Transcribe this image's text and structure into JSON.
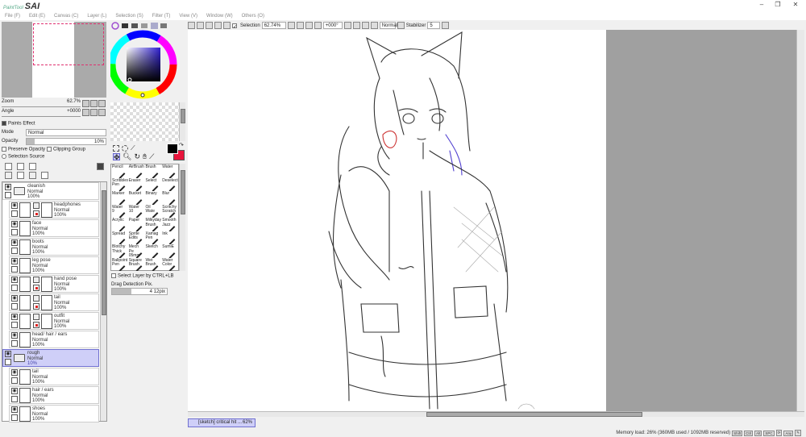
{
  "app": {
    "logo_small": "PaintTool",
    "logo": "SAI"
  },
  "menu": [
    "File (F)",
    "Edit (E)",
    "Canvas (C)",
    "Layer (L)",
    "Selection (S)",
    "Filter (T)",
    "View (V)",
    "Window (W)",
    "Others (O)"
  ],
  "toolbar": {
    "selection_label": "Selection",
    "zoom": "62.74%",
    "angle": "+000°",
    "mode": "Normal",
    "stabilizer_label": "Stabilizer",
    "stabilizer": "5"
  },
  "navigator": {
    "zoom_label": "Zoom",
    "zoom_value": "62.7%",
    "angle_label": "Angle",
    "angle_value": "+0000"
  },
  "paints": {
    "title": "Paints Effect",
    "mode_label": "Mode",
    "mode_value": "Normal",
    "opacity_label": "Opacity",
    "opacity_value": "10%",
    "opacity_fraction": 0.1,
    "preserve_opacity": "Preserve Opacity",
    "clipping_group": "Clipping Group",
    "selection_source": "Selection Source"
  },
  "layers": [
    {
      "name": "cleanish",
      "mode": "Normal",
      "opacity": "100%",
      "type": "folder"
    },
    {
      "name": "headphones",
      "mode": "Normal",
      "opacity": "100%",
      "type": "masked"
    },
    {
      "name": "face",
      "mode": "Normal",
      "opacity": "100%",
      "type": "layer"
    },
    {
      "name": "boots",
      "mode": "Normal",
      "opacity": "100%",
      "type": "layer"
    },
    {
      "name": "leg pose",
      "mode": "Normal",
      "opacity": "100%",
      "type": "layer"
    },
    {
      "name": "hand pose",
      "mode": "Normal",
      "opacity": "100%",
      "type": "masked"
    },
    {
      "name": "tail",
      "mode": "Normal",
      "opacity": "100%",
      "type": "masked"
    },
    {
      "name": "outfit",
      "mode": "Normal",
      "opacity": "100%",
      "type": "masked"
    },
    {
      "name": "head/ hair / ears",
      "mode": "Normal",
      "opacity": "100%",
      "type": "layer"
    },
    {
      "name": "rough",
      "mode": "Normal",
      "opacity": "10%",
      "type": "folder-selected"
    },
    {
      "name": "tail",
      "mode": "Normal",
      "opacity": "100%",
      "type": "layer"
    },
    {
      "name": "hair / ears",
      "mode": "Normal",
      "opacity": "100%",
      "type": "layer"
    },
    {
      "name": "shoes",
      "mode": "Normal",
      "opacity": "100%",
      "type": "layer"
    }
  ],
  "colors": {
    "primary": "#000000",
    "secondary": "#e8143c",
    "accent_selected": "#cfcff8"
  },
  "brushes": [
    [
      "Pencil",
      ""
    ],
    [
      "AirBrush",
      ""
    ],
    [
      "Brush",
      ""
    ],
    [
      "Water",
      ""
    ],
    [
      "Scribbles",
      "Pen"
    ],
    [
      "Eraser",
      ""
    ],
    [
      "Select",
      ""
    ],
    [
      "Deselect",
      ""
    ],
    [
      "Marker",
      ""
    ],
    [
      "Bucket",
      ""
    ],
    [
      "Binary",
      ""
    ],
    [
      "Blur",
      ""
    ],
    [
      "Water",
      "9"
    ],
    [
      "Water",
      "10"
    ],
    [
      "Oil Wate",
      ""
    ],
    [
      "Scritchy",
      "Scratch"
    ],
    [
      "Acrylic",
      ""
    ],
    [
      "Paper",
      ""
    ],
    [
      "Milkyday",
      "Brush"
    ],
    [
      "Smooth",
      "Jazz"
    ],
    [
      "Spread",
      ""
    ],
    [
      "Sprite",
      "Edits"
    ],
    [
      "Xamag",
      "Pen"
    ],
    [
      "Ink",
      ""
    ],
    [
      "Blotchy",
      "Thick"
    ],
    [
      "Mech Pe",
      "05mm"
    ],
    [
      "Sketch",
      ""
    ],
    [
      "SumiE",
      ""
    ],
    [
      "Ballpoint",
      "Pen"
    ],
    [
      "Square",
      "Brush"
    ],
    [
      "Wet",
      "Brush"
    ],
    [
      "Water",
      "Color"
    ]
  ],
  "options": {
    "select_layer": "Select Layer by CTRL+LB",
    "drag_label": "Drag Detection Pix.",
    "drag_value": "4 12pix"
  },
  "status": {
    "tab": "[sketch] critical hit ...",
    "tab_zoom": "62%",
    "memory": "Memory load: 26% (360MB used / 1092MB reserved)",
    "keys": [
      "Shift",
      "Ctrl",
      "Alt",
      "SPC",
      "⟳",
      "Any",
      "✎"
    ]
  }
}
